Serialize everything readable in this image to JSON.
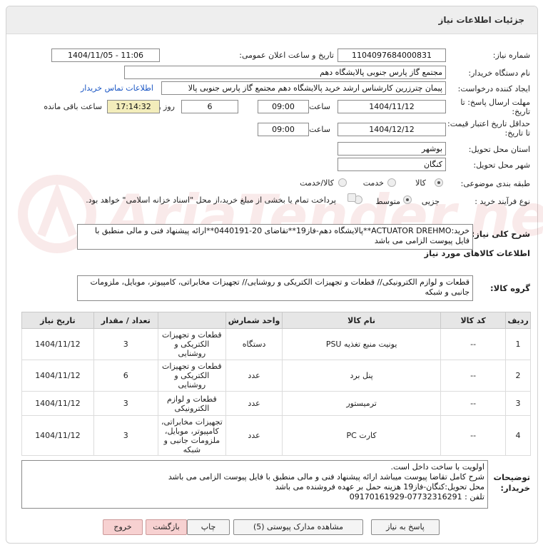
{
  "page": {
    "title": "جزئیات اطلاعات نیاز"
  },
  "watermark": {
    "text": "AriaTender.net"
  },
  "form": {
    "need_number": {
      "label": "شماره نیاز:",
      "value": "1104097684000831"
    },
    "announce": {
      "label": "تاریخ و ساعت اعلان عمومی:",
      "value": "1404/11/05 - 11:06"
    },
    "buyer_org": {
      "label": "نام دستگاه خریدار:",
      "value": "مجتمع گاز پارس جنوبی  پالایشگاه دهم"
    },
    "requester": {
      "label": "ایجاد کننده درخواست:",
      "value": "پیمان چترزرین کارشناس ارشد خرید پالایشگاه دهم مجتمع گاز پارس جنوبی  پالا",
      "contact_link": "اطلاعات تماس خریدار"
    },
    "deadline": {
      "label": "مهلت ارسال پاسخ: تا تاریخ:",
      "date": "1404/11/12",
      "time_label": "ساعت",
      "time": "09:00",
      "days": "6",
      "days_label": "روز و",
      "remaining": "17:14:32",
      "remaining_label": "ساعت باقی مانده"
    },
    "validity": {
      "label": "حداقل تاریخ اعتبار قیمت: تا تاریخ:",
      "date": "1404/12/12",
      "time_label": "ساعت",
      "time": "09:00"
    },
    "province": {
      "label": "استان محل تحویل:",
      "value": "بوشهر"
    },
    "city": {
      "label": "شهر محل تحویل:",
      "value": "کنگان"
    },
    "category": {
      "label": "طبقه بندی موضوعی:",
      "options": [
        "کالا",
        "خدمت",
        "کالا/خدمت"
      ],
      "selected": 0
    },
    "process": {
      "label": "نوع فرآیند خرید :",
      "options": [
        "جزیی",
        "متوسط"
      ],
      "selected": 0,
      "checkbox_text": "پرداخت تمام یا بخشی از مبلغ خرید،از محل \"اسناد خزانه اسلامی\" خواهد بود."
    }
  },
  "description": {
    "label": "شرح کلی نیاز:",
    "text": "خرید:ACTUATOR DREHMO**پالایشگاه دهم-فاز19**تقاضای 20-0440191**ارائه پیشنهاد فنی و مالی منطبق با فایل پیوست الزامی می باشد"
  },
  "goods_info_title": "اطلاعات کالاهای مورد نیاز",
  "goods_group": {
    "label": "گروه کالا:",
    "text": "قطعات و لوازم الکترونیکی// قطعات و تجهیزات الکتریکی و روشنایی// تجهیزات مخابراتی، کامپیوتر، موبایل، ملزومات جانبی و شبکه"
  },
  "table": {
    "headers": [
      "ردیف",
      "کد کالا",
      "نام کالا",
      "واحد شمارش",
      "تعداد / مقدار",
      "تاریخ نیاز"
    ],
    "rows": [
      {
        "row": "1",
        "code": "--",
        "name": "یونیت منبع تغذیه PSU",
        "unit": "دستگاه",
        "group": "قطعات و تجهیزات الکتریکی و روشنایی",
        "qty": "3",
        "date": "1404/11/12"
      },
      {
        "row": "2",
        "code": "--",
        "name": "پنل برد",
        "unit": "عدد",
        "group": "قطعات و تجهیزات الکتریکی و روشنایی",
        "qty": "6",
        "date": "1404/11/12"
      },
      {
        "row": "3",
        "code": "--",
        "name": "ترمیستور",
        "unit": "عدد",
        "group": "قطعات و لوازم الکترونیکی",
        "qty": "3",
        "date": "1404/11/12"
      },
      {
        "row": "4",
        "code": "--",
        "name": "کارت PC",
        "unit": "عدد",
        "group": "تجهیزات مخابراتی، کامپیوتر، موبایل، ملزومات جانبی و شبکه",
        "qty": "3",
        "date": "1404/11/12"
      }
    ]
  },
  "buyer_notes": {
    "label_1": "توضیحات",
    "label_2": "خریدار:",
    "lines": [
      "اولویت با ساخت داخل است.",
      "شرح کامل تقاضا پیوست میباشد ارائه پیشنهاد فنی و مالی منطبق با فایل پیوست الزامی می باشد",
      "محل تحویل:کنگان-فاز19 هزینه حمل بر عهده فروشنده می باشد",
      "تلفن : 07732316291-09170161929"
    ]
  },
  "buttons": {
    "reply": "پاسخ به نیاز",
    "attachments": "مشاهده مدارک پیوستی (5)",
    "print": "چاپ",
    "back": "بازگشت",
    "exit": "خروج"
  }
}
